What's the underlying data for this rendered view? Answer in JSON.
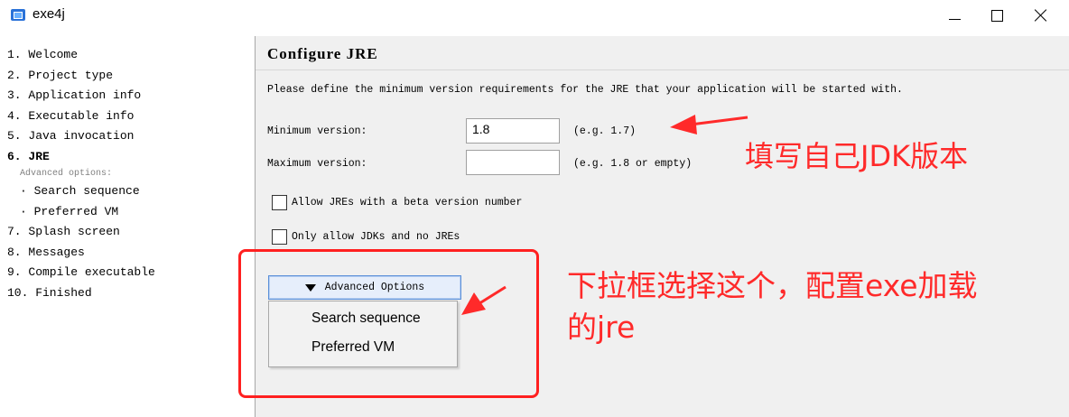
{
  "window": {
    "title": "exe4j",
    "minimize_icon": "minimize-icon",
    "maximize_icon": "maximize-icon",
    "close_icon": "close-icon"
  },
  "steps": [
    {
      "label": "1. Welcome",
      "type": "step"
    },
    {
      "label": "2. Project type",
      "type": "step"
    },
    {
      "label": "3. Application info",
      "type": "step"
    },
    {
      "label": "4. Executable info",
      "type": "step"
    },
    {
      "label": "5. Java invocation",
      "type": "step"
    },
    {
      "label": "6.  JRE",
      "type": "active"
    },
    {
      "label": "Advanced options:",
      "type": "sub-header"
    },
    {
      "label": "· Search sequence",
      "type": "sub"
    },
    {
      "label": "· Preferred VM",
      "type": "sub"
    },
    {
      "label": "7. Splash screen",
      "type": "step"
    },
    {
      "label": "8. Messages",
      "type": "step"
    },
    {
      "label": "9. Compile executable",
      "type": "step"
    },
    {
      "label": "10. Finished",
      "type": "step"
    }
  ],
  "pane": {
    "title": "Configure JRE",
    "description": "Please define the minimum version requirements for the JRE that your application will be started with.",
    "min_label": "Minimum version:",
    "min_value": "1.8",
    "min_hint": "(e.g. 1.7)",
    "max_label": "Maximum version:",
    "max_value": "",
    "max_hint": "(e.g. 1.8 or empty)",
    "beta_label": "Allow JREs with a beta version number",
    "jdk_label": "Only allow JDKs and no JREs",
    "advanced_button": "Advanced Options",
    "menu_items": [
      "Search sequence",
      "Preferred VM"
    ]
  },
  "annotations": {
    "text1": "填写自己JDK版本",
    "text2_line1": "下拉框选择这个，配置exe加载",
    "text2_line2": "的jre",
    "color": "#ff2a2a"
  }
}
